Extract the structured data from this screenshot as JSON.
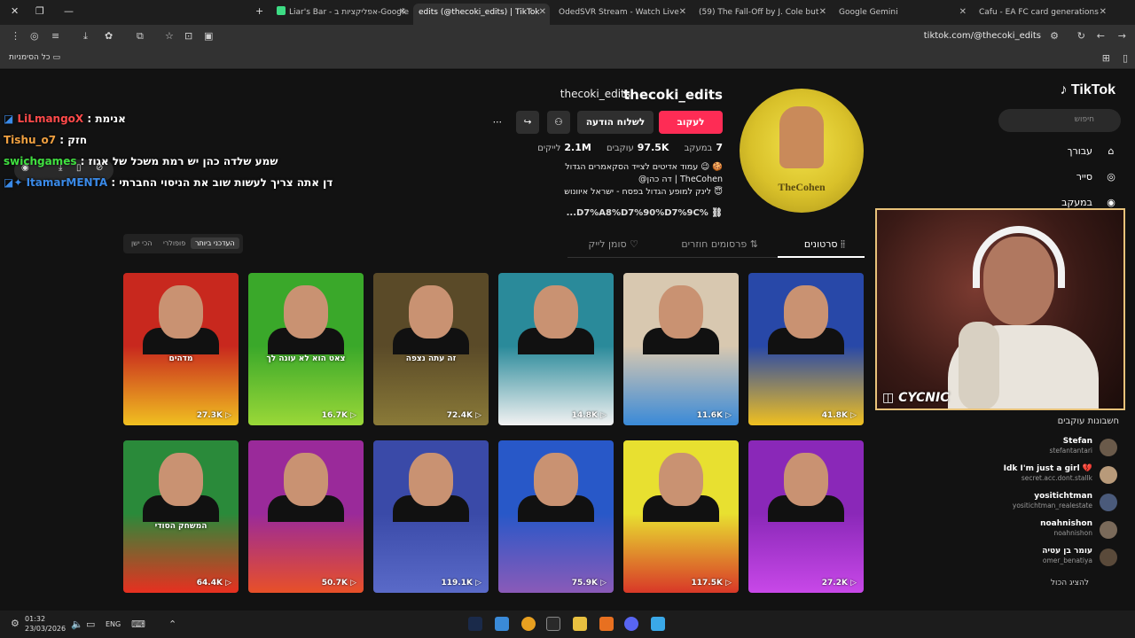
{
  "browser": {
    "tabs": [
      {
        "label": "Liar's Bar - אפליקציות ב-Google",
        "active": false
      },
      {
        "label": "edits (@thecoki_edits) | TikTok",
        "active": true
      },
      {
        "label": "OdedSVR Stream - Watch Live",
        "active": false
      },
      {
        "label": "(59) The Fall-Off by J. Cole but",
        "active": false
      },
      {
        "label": "Google Gemini",
        "active": false
      },
      {
        "label": "Cafu - EA FC card generations",
        "active": false
      }
    ],
    "url": "tiktok.com/@thecoki_edits",
    "bookmarks_label": "כל הסימניות"
  },
  "tiktok": {
    "logo": "TikTok",
    "search_placeholder": "חיפוש",
    "nav": [
      {
        "label": "עבורך",
        "icon": "home-icon"
      },
      {
        "label": "סייר",
        "icon": "compass-icon"
      },
      {
        "label": "במעקב",
        "icon": "following-icon"
      }
    ],
    "following_title": "חשבונות עוקבים",
    "following": [
      {
        "name": "Stefan",
        "handle": "stefantantari"
      },
      {
        "name": "Idk I'm just a girl 💔",
        "handle": "secret.acc.dont.stallk"
      },
      {
        "name": "yositichtman",
        "handle": "yositichtman_realestate"
      },
      {
        "name": "noahnishon",
        "handle": "noahnishon"
      },
      {
        "name": "עומר בן עטיה",
        "handle": "omer_benatiya"
      }
    ],
    "show_all": "להציג הכול"
  },
  "profile": {
    "username": "thecoki_edits",
    "display_name": "thecoki_edits",
    "avatar_text": "TheCohen",
    "follow": "לעקוב",
    "message": "לשלוח הודעה",
    "stats": {
      "following_value": "7",
      "following_label": "במעקב",
      "followers_value": "97.5K",
      "followers_label": "עוקבים",
      "likes_value": "2.1M",
      "likes_label": "לייקים"
    },
    "bio": [
      "עמוד אדיטים לצייד הסקאמרים הגדול 😉 🍪",
      "@דה כהן | TheCohen",
      "לינק למופע הגדול בפסח - ישראל איוונוש 😇"
    ],
    "link": "...D7%A8%D7%90%D7%9C%"
  },
  "content_tabs": {
    "videos": "סרטונים",
    "reposts": "פרסומים חוזרים",
    "liked": "סומן לייק"
  },
  "sort": {
    "latest": "העדכני ביותר",
    "popular": "פופולרי",
    "oldest": "הכי ישן"
  },
  "videos": [
    {
      "views": "27.3K",
      "caption": "מדהים",
      "bg": "#c8281e",
      "accent": "#f0c020"
    },
    {
      "views": "16.7K",
      "caption": "צאט הוא לא עונה לך",
      "bg": "#3aa82a",
      "accent": "#9ad838"
    },
    {
      "views": "72.4K",
      "caption": "זה עתה נצפה",
      "bg": "#5a4a28",
      "accent": "#8a7a38"
    },
    {
      "views": "14.8K",
      "caption": "",
      "bg": "#2a8a9a",
      "accent": "#f2f2f2"
    },
    {
      "views": "11.6K",
      "caption": "",
      "bg": "#d8c8b0",
      "accent": "#3a8ad8"
    },
    {
      "views": "41.8K",
      "caption": "",
      "bg": "#2848a8",
      "accent": "#f0c020"
    },
    {
      "views": "64.4K",
      "caption": "המשחק הסודי",
      "bg": "#2a8a3a",
      "accent": "#e83020"
    },
    {
      "views": "50.7K",
      "caption": "",
      "bg": "#9a2a9a",
      "accent": "#e85028"
    },
    {
      "views": "119.1K",
      "caption": "",
      "bg": "#3a4aa8",
      "accent": "#5a6ac8"
    },
    {
      "views": "75.9K",
      "caption": "",
      "bg": "#2858c8",
      "accent": "#8a5ab8"
    },
    {
      "views": "117.5K",
      "caption": "",
      "bg": "#e8e030",
      "accent": "#d83828"
    },
    {
      "views": "27.2K",
      "caption": "",
      "bg": "#8a28b8",
      "accent": "#c848e8"
    }
  ],
  "overlay": {
    "chat": [
      {
        "user": "LiLmangoX",
        "text": "אנימת",
        "color": "#ff4a4a"
      },
      {
        "user": "Tishu_o7",
        "text": "חזק",
        "color": "#f0a040"
      },
      {
        "user": "swichgames",
        "text": "שמע שלדה כהן יש רמת משכל של אגוז",
        "color": "#40e040"
      },
      {
        "user": "ItamarMENTA",
        "text": "דן אתה צריך לעשות שוב את הניסוי החברתי",
        "color": "#3a8ae8"
      }
    ],
    "webcam_tag": "CYCNIC"
  },
  "taskbar": {
    "time": "01:32",
    "date": "23/03/2026",
    "lang": "ENG"
  }
}
